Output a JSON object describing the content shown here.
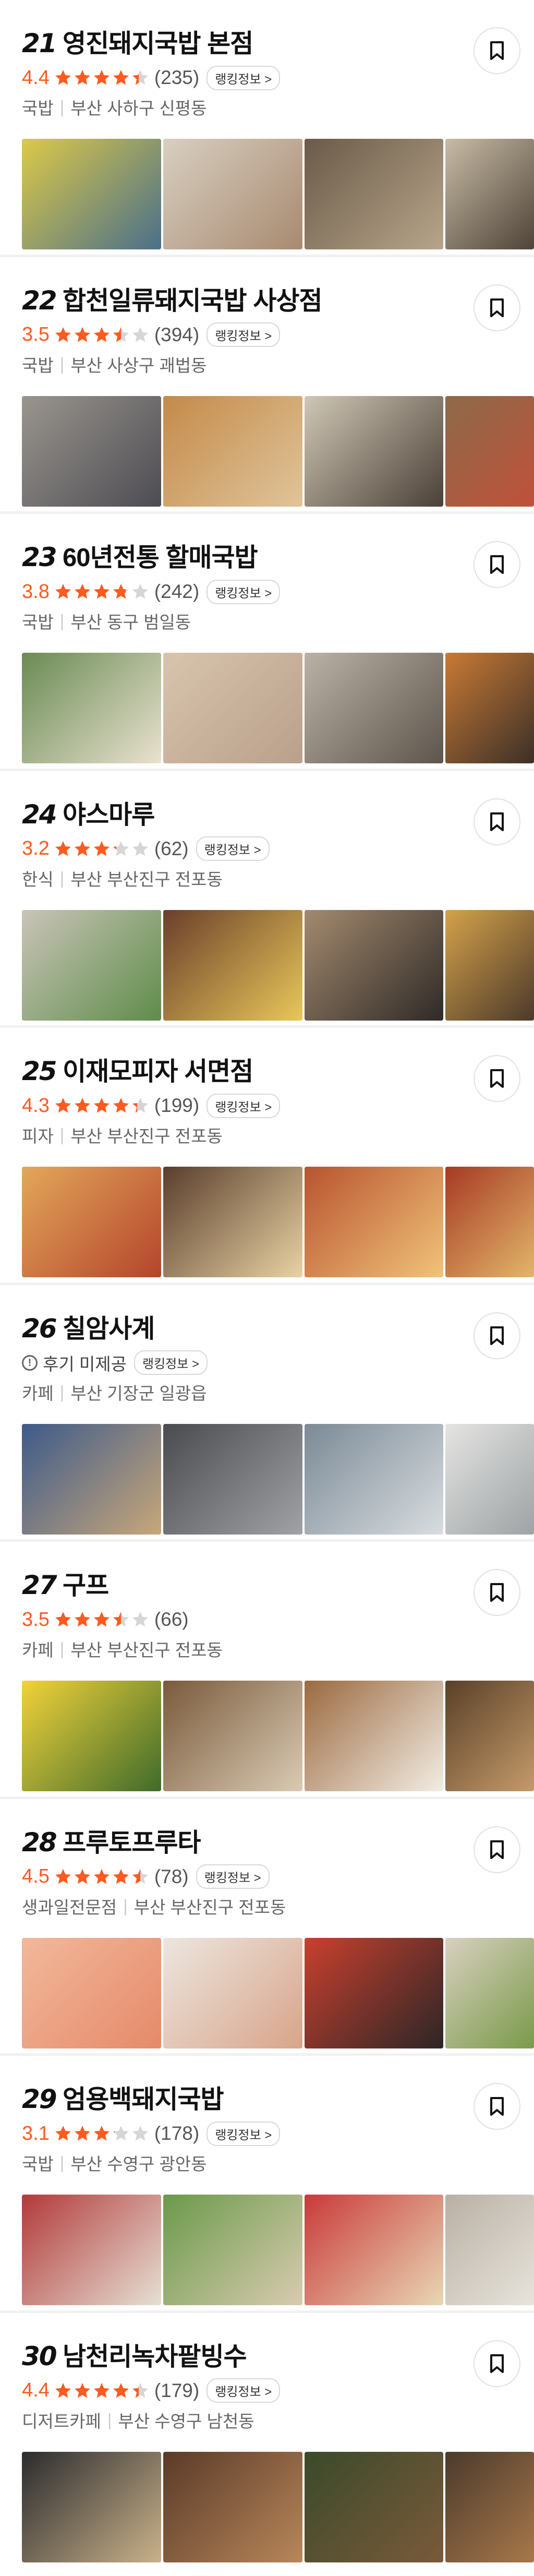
{
  "icons": {
    "bookmark": "bookmark-icon",
    "star": "star-icon",
    "review": "info-circle-icon"
  },
  "colors": {
    "accent": "#ff5a1f",
    "star_fill": "#ff5a1f",
    "star_empty": "#d6d6d6"
  },
  "restaurants": [
    {
      "rank": "21",
      "name": "영진돼지국밥 본점",
      "score": "4.4",
      "rating": 4.4,
      "count": "(235)",
      "badge": "랭킹정보 >",
      "category": "국밥",
      "location": "부산 사하구 신평동",
      "photo_colors": [
        [
          "#dcc94a",
          "#4a6f8a"
        ],
        [
          "#d8cfc1",
          "#a88a70"
        ],
        [
          "#6b5a48",
          "#b7a58a"
        ],
        [
          "#c8bba6",
          "#4f4438"
        ]
      ]
    },
    {
      "rank": "22",
      "name": "합천일류돼지국밥 사상점",
      "score": "3.5",
      "rating": 3.5,
      "count": "(394)",
      "badge": "랭킹정보 >",
      "category": "국밥",
      "location": "부산 사상구 괘법동",
      "photo_colors": [
        [
          "#9a958e",
          "#4d4c52"
        ],
        [
          "#c48a4a",
          "#e0c49a"
        ],
        [
          "#cfc7b5",
          "#4b4037"
        ],
        [
          "#8d6a4a",
          "#c0513a"
        ]
      ]
    },
    {
      "rank": "23",
      "name": "60년전통 할매국밥",
      "score": "3.8",
      "rating": 3.8,
      "count": "(242)",
      "badge": "랭킹정보 >",
      "category": "국밥",
      "location": "부산 동구 범일동",
      "photo_colors": [
        [
          "#6a8b54",
          "#e9e1cf"
        ],
        [
          "#d8c4ae",
          "#b9a08a"
        ],
        [
          "#b9b2a5",
          "#5e554c"
        ],
        [
          "#c97a35",
          "#3c3027"
        ]
      ]
    },
    {
      "rank": "24",
      "name": "야스마루",
      "score": "3.2",
      "rating": 3.2,
      "count": "(62)",
      "badge": "랭킹정보 >",
      "category": "한식",
      "location": "부산 부산진구 전포동",
      "photo_colors": [
        [
          "#c9c4b8",
          "#5f8c4a"
        ],
        [
          "#6b3f2b",
          "#e8c75a"
        ],
        [
          "#a38a6f",
          "#2f2a27"
        ],
        [
          "#d4a24a",
          "#4c3a2a"
        ]
      ]
    },
    {
      "rank": "25",
      "name": "이재모피자 서면점",
      "score": "4.3",
      "rating": 4.3,
      "count": "(199)",
      "badge": "랭킹정보 >",
      "category": "피자",
      "location": "부산 부산진구 전포동",
      "photo_colors": [
        [
          "#e3a75a",
          "#b4452c"
        ],
        [
          "#5a3e2c",
          "#e9d2a4"
        ],
        [
          "#b8542f",
          "#f0c37a"
        ],
        [
          "#a63a24",
          "#e2b66a"
        ]
      ]
    },
    {
      "rank": "26",
      "name": "칠암사계",
      "review": "후기 미제공",
      "badge": "랭킹정보 >",
      "category": "카페",
      "location": "부산 기장군 일광읍",
      "photo_colors": [
        [
          "#3d5a8a",
          "#c7a77a"
        ],
        [
          "#4a4b4e",
          "#a0a2a6"
        ],
        [
          "#7b8a96",
          "#d9dde0"
        ],
        [
          "#e4e4e2",
          "#9ea3a5"
        ]
      ]
    },
    {
      "rank": "27",
      "name": "구프",
      "score": "3.5",
      "rating": 3.5,
      "count": "(66)",
      "category": "카페",
      "location": "부산 부산진구 전포동",
      "photo_colors": [
        [
          "#f2d23a",
          "#3f6b2a"
        ],
        [
          "#7a5a3c",
          "#d9cbb3"
        ],
        [
          "#9b6a3f",
          "#f2ede4"
        ],
        [
          "#5a4028",
          "#c49a6a"
        ]
      ]
    },
    {
      "rank": "28",
      "name": "프루토프루타",
      "score": "4.5",
      "rating": 4.5,
      "count": "(78)",
      "badge": "랭킹정보 >",
      "category": "생과일전문점",
      "location": "부산 부산진구 전포동",
      "photo_colors": [
        [
          "#f2b89a",
          "#e58a6a"
        ],
        [
          "#ece6df",
          "#d8a48a"
        ],
        [
          "#c9402e",
          "#2c2626"
        ],
        [
          "#d8d0bf",
          "#7a9a4a"
        ]
      ]
    },
    {
      "rank": "29",
      "name": "엄용백돼지국밥",
      "score": "3.1",
      "rating": 3.1,
      "count": "(178)",
      "badge": "랭킹정보 >",
      "category": "국밥",
      "location": "부산 수영구 광안동",
      "photo_colors": [
        [
          "#b23a3a",
          "#e6e0d4"
        ],
        [
          "#6a9a4a",
          "#d9cbb0"
        ],
        [
          "#c93a3a",
          "#e8d7b4"
        ],
        [
          "#b9b0a4",
          "#e8e4dc"
        ]
      ]
    },
    {
      "rank": "30",
      "name": "남천리녹차팥빙수",
      "score": "4.4",
      "rating": 4.4,
      "count": "(179)",
      "badge": "랭킹정보 >",
      "category": "디저트카페",
      "location": "부산 수영구 남천동",
      "photo_colors": [
        [
          "#2b2b2e",
          "#c9b28a"
        ],
        [
          "#5a3a28",
          "#b8875a"
        ],
        [
          "#3a4a2a",
          "#7a5a3a"
        ],
        [
          "#4b3a2c",
          "#a8784a"
        ]
      ]
    }
  ]
}
